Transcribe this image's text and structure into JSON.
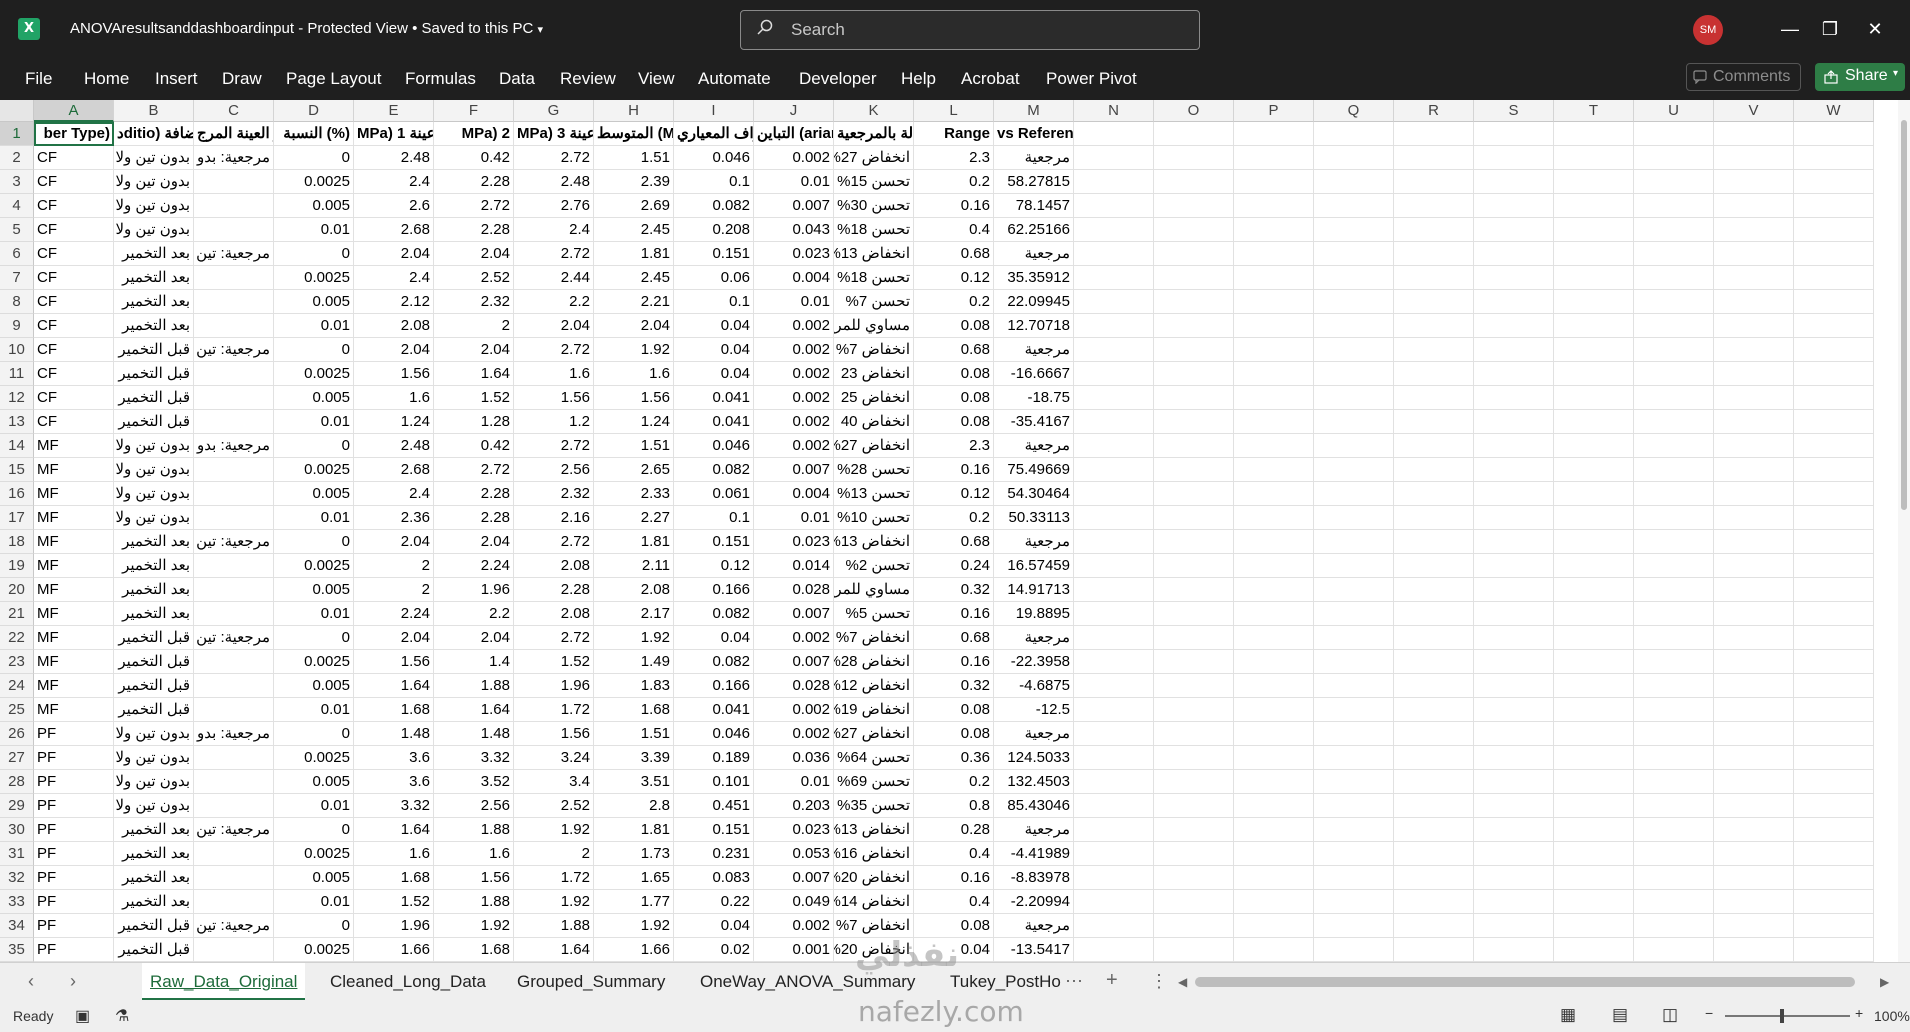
{
  "titlebar": {
    "app_icon": "excel-icon",
    "title": "ANOVAresultsanddashboardinput  -  Protected View  •  Saved to this PC",
    "search_placeholder": "Search",
    "avatar": "SM"
  },
  "ribbon": {
    "tabs": [
      "File",
      "Home",
      "Insert",
      "Draw",
      "Page Layout",
      "Formulas",
      "Data",
      "Review",
      "View",
      "Automate",
      "Developer",
      "Help",
      "Acrobat",
      "Power Pivot"
    ],
    "comments": "Comments",
    "share": "Share"
  },
  "columns": [
    "A",
    "B",
    "C",
    "D",
    "E",
    "F",
    "G",
    "H",
    "I",
    "J",
    "K",
    "L",
    "M",
    "N",
    "O",
    "P",
    "Q",
    "R",
    "S",
    "T",
    "U",
    "V",
    "W"
  ],
  "header_row": [
    "ber Type)",
    "دditio) الإضافة",
    "ر العينة المرج",
    "النسبة (%)",
    "MPa) 1 عينة",
    "MPa) 2",
    "MPa) 3 عينة",
    "المتوسط (Mean)",
    "الانحراف المعياري",
    "التباين (ariance",
    "الحالة بالمرجعية",
    "Range",
    "vs Reference"
  ],
  "rows": [
    [
      "CF",
      "بدون تين ولا",
      "مرجعية: بدو",
      "0",
      "2.48",
      "0.42",
      "2.72",
      "1.51",
      "0.046",
      "0.002",
      "انخفاض 27%",
      "2.3",
      "مرجعية"
    ],
    [
      "CF",
      "بدون تين ولا",
      "",
      "0.0025",
      "2.4",
      "2.28",
      "2.48",
      "2.39",
      "0.1",
      "0.01",
      "تحسن 15%",
      "0.2",
      "58.27815"
    ],
    [
      "CF",
      "بدون تين ولا",
      "",
      "0.005",
      "2.6",
      "2.72",
      "2.76",
      "2.69",
      "0.082",
      "0.007",
      "تحسن 30%",
      "0.16",
      "78.1457"
    ],
    [
      "CF",
      "بدون تين ولا",
      "",
      "0.01",
      "2.68",
      "2.28",
      "2.4",
      "2.45",
      "0.208",
      "0.043",
      "تحسن 18%",
      "0.4",
      "62.25166"
    ],
    [
      "CF",
      "بعد التخمير",
      "مرجعية: تين",
      "0",
      "2.04",
      "2.04",
      "2.72",
      "1.81",
      "0.151",
      "0.023",
      "انخفاض 13%",
      "0.68",
      "مرجعية"
    ],
    [
      "CF",
      "بعد التخمير",
      "",
      "0.0025",
      "2.4",
      "2.52",
      "2.44",
      "2.45",
      "0.06",
      "0.004",
      "تحسن 18%",
      "0.12",
      "35.35912"
    ],
    [
      "CF",
      "بعد التخمير",
      "",
      "0.005",
      "2.12",
      "2.32",
      "2.2",
      "2.21",
      "0.1",
      "0.01",
      "تحسن 7%",
      "0.2",
      "22.09945"
    ],
    [
      "CF",
      "بعد التخمير",
      "",
      "0.01",
      "2.08",
      "2",
      "2.04",
      "2.04",
      "0.04",
      "0.002",
      "مساوي للمرج",
      "0.08",
      "12.70718"
    ],
    [
      "CF",
      "قبل التخمير",
      "مرجعية: تين",
      "0",
      "2.04",
      "2.04",
      "2.72",
      "1.92",
      "0.04",
      "0.002",
      "انخفاض 7%",
      "0.68",
      "مرجعية"
    ],
    [
      "CF",
      "قبل التخمير",
      "",
      "0.0025",
      "1.56",
      "1.64",
      "1.6",
      "1.6",
      "0.04",
      "0.002",
      "انخفاض 23",
      "0.08",
      "-16.6667"
    ],
    [
      "CF",
      "قبل التخمير",
      "",
      "0.005",
      "1.6",
      "1.52",
      "1.56",
      "1.56",
      "0.041",
      "0.002",
      "انخفاض 25",
      "0.08",
      "-18.75"
    ],
    [
      "CF",
      "قبل التخمير",
      "",
      "0.01",
      "1.24",
      "1.28",
      "1.2",
      "1.24",
      "0.041",
      "0.002",
      "انخفاض 40",
      "0.08",
      "-35.4167"
    ],
    [
      "MF",
      "بدون تين ولا",
      "مرجعية: بدو",
      "0",
      "2.48",
      "0.42",
      "2.72",
      "1.51",
      "0.046",
      "0.002",
      "انخفاض 27%",
      "2.3",
      "مرجعية"
    ],
    [
      "MF",
      "بدون تين ولا",
      "",
      "0.0025",
      "2.68",
      "2.72",
      "2.56",
      "2.65",
      "0.082",
      "0.007",
      "تحسن 28%",
      "0.16",
      "75.49669"
    ],
    [
      "MF",
      "بدون تين ولا",
      "",
      "0.005",
      "2.4",
      "2.28",
      "2.32",
      "2.33",
      "0.061",
      "0.004",
      "تحسن 13%",
      "0.12",
      "54.30464"
    ],
    [
      "MF",
      "بدون تين ولا",
      "",
      "0.01",
      "2.36",
      "2.28",
      "2.16",
      "2.27",
      "0.1",
      "0.01",
      "تحسن 10%",
      "0.2",
      "50.33113"
    ],
    [
      "MF",
      "بعد التخمير",
      "مرجعية: تين",
      "0",
      "2.04",
      "2.04",
      "2.72",
      "1.81",
      "0.151",
      "0.023",
      "انخفاض 13%",
      "0.68",
      "مرجعية"
    ],
    [
      "MF",
      "بعد التخمير",
      "",
      "0.0025",
      "2",
      "2.24",
      "2.08",
      "2.11",
      "0.12",
      "0.014",
      "تحسن 2%",
      "0.24",
      "16.57459"
    ],
    [
      "MF",
      "بعد التخمير",
      "",
      "0.005",
      "2",
      "1.96",
      "2.28",
      "2.08",
      "0.166",
      "0.028",
      "مساوي للمرج",
      "0.32",
      "14.91713"
    ],
    [
      "MF",
      "بعد التخمير",
      "",
      "0.01",
      "2.24",
      "2.2",
      "2.08",
      "2.17",
      "0.082",
      "0.007",
      "تحسن 5%",
      "0.16",
      "19.8895"
    ],
    [
      "MF",
      "قبل التخمير",
      "مرجعية: تين",
      "0",
      "2.04",
      "2.04",
      "2.72",
      "1.92",
      "0.04",
      "0.002",
      "انخفاض 7%",
      "0.68",
      "مرجعية"
    ],
    [
      "MF",
      "قبل التخمير",
      "",
      "0.0025",
      "1.56",
      "1.4",
      "1.52",
      "1.49",
      "0.082",
      "0.007",
      "انخفاض 28%",
      "0.16",
      "-22.3958"
    ],
    [
      "MF",
      "قبل التخمير",
      "",
      "0.005",
      "1.64",
      "1.88",
      "1.96",
      "1.83",
      "0.166",
      "0.028",
      "انخفاض 12%",
      "0.32",
      "-4.6875"
    ],
    [
      "MF",
      "قبل التخمير",
      "",
      "0.01",
      "1.68",
      "1.64",
      "1.72",
      "1.68",
      "0.041",
      "0.002",
      "انخفاض 19%",
      "0.08",
      "-12.5"
    ],
    [
      "PF",
      "بدون تين ولا",
      "مرجعية: بدو",
      "0",
      "1.48",
      "1.48",
      "1.56",
      "1.51",
      "0.046",
      "0.002",
      "انخفاض 27%",
      "0.08",
      "مرجعية"
    ],
    [
      "PF",
      "بدون تين ولا",
      "",
      "0.0025",
      "3.6",
      "3.32",
      "3.24",
      "3.39",
      "0.189",
      "0.036",
      "تحسن 64%",
      "0.36",
      "124.5033"
    ],
    [
      "PF",
      "بدون تين ولا",
      "",
      "0.005",
      "3.6",
      "3.52",
      "3.4",
      "3.51",
      "0.101",
      "0.01",
      "تحسن 69%",
      "0.2",
      "132.4503"
    ],
    [
      "PF",
      "بدون تين ولا",
      "",
      "0.01",
      "3.32",
      "2.56",
      "2.52",
      "2.8",
      "0.451",
      "0.203",
      "تحسن 35%",
      "0.8",
      "85.43046"
    ],
    [
      "PF",
      "بعد التخمير",
      "مرجعية: تين",
      "0",
      "1.64",
      "1.88",
      "1.92",
      "1.81",
      "0.151",
      "0.023",
      "انخفاض 13%",
      "0.28",
      "مرجعية"
    ],
    [
      "PF",
      "بعد التخمير",
      "",
      "0.0025",
      "1.6",
      "1.6",
      "2",
      "1.73",
      "0.231",
      "0.053",
      "انخفاض 16%",
      "0.4",
      "-4.41989"
    ],
    [
      "PF",
      "بعد التخمير",
      "",
      "0.005",
      "1.68",
      "1.56",
      "1.72",
      "1.65",
      "0.083",
      "0.007",
      "انخفاض 20%",
      "0.16",
      "-8.83978"
    ],
    [
      "PF",
      "بعد التخمير",
      "",
      "0.01",
      "1.52",
      "1.88",
      "1.92",
      "1.77",
      "0.22",
      "0.049",
      "انخفاض 14%",
      "0.4",
      "-2.20994"
    ],
    [
      "PF",
      "قبل التخمير",
      "مرجعية: تين",
      "0",
      "1.96",
      "1.92",
      "1.88",
      "1.92",
      "0.04",
      "0.002",
      "انخفاض 7%",
      "0.08",
      "مرجعية"
    ],
    [
      "PF",
      "قبل التخمير",
      "",
      "0.0025",
      "1.66",
      "1.68",
      "1.64",
      "1.66",
      "0.02",
      "0.001",
      "انخفاض 20%",
      "0.04",
      "-13.5417"
    ]
  ],
  "sheets": [
    "Raw_Data_Original",
    "Cleaned_Long_Data",
    "Grouped_Summary",
    "OneWay_ANOVA_Summary",
    "Tukey_PostHo"
  ],
  "active_sheet": "Raw_Data_Original",
  "status": {
    "ready": "Ready",
    "zoom": "100%"
  },
  "watermark": {
    "arabic": "نفذلي",
    "latin": "nafezly.com"
  }
}
